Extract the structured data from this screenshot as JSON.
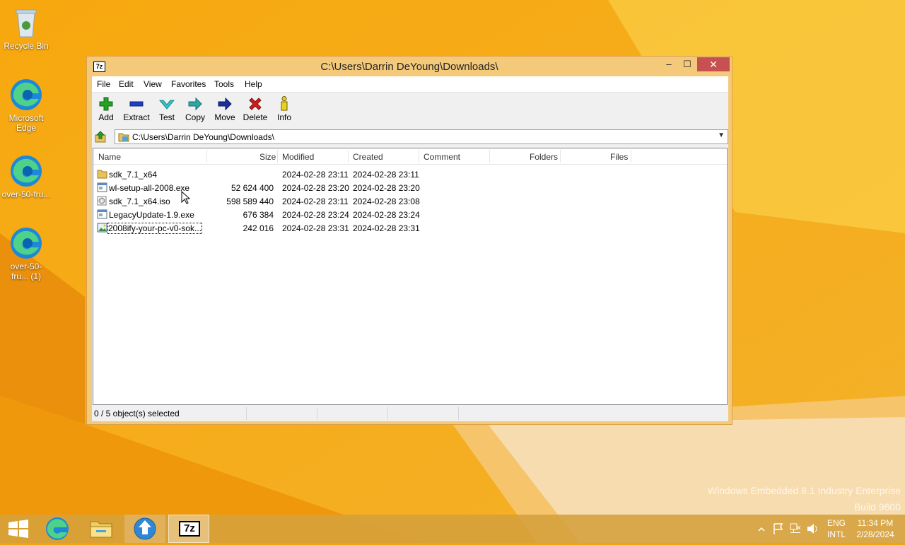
{
  "desktop": {
    "icons": [
      {
        "label": "Recycle Bin"
      },
      {
        "label": "Microsoft Edge"
      },
      {
        "label": "over-50-fru..."
      },
      {
        "label": "over-50-fru... (1)"
      }
    ],
    "watermark": {
      "line1": "Windows Embedded 8.1 Industry Enterprise",
      "line2": "Build 9600"
    }
  },
  "window": {
    "app_icon": "7z",
    "title": "C:\\Users\\Darrin DeYoung\\Downloads\\",
    "controls": {
      "minimize": "–",
      "maximize": "☐",
      "close": "✕"
    },
    "menu": [
      "File",
      "Edit",
      "View",
      "Favorites",
      "Tools",
      "Help"
    ],
    "toolbar": [
      {
        "label": "Add",
        "icon": "plus-icon"
      },
      {
        "label": "Extract",
        "icon": "minus-icon"
      },
      {
        "label": "Test",
        "icon": "check-icon"
      },
      {
        "label": "Copy",
        "icon": "copy-arrow-icon"
      },
      {
        "label": "Move",
        "icon": "move-arrow-icon"
      },
      {
        "label": "Delete",
        "icon": "delete-x-icon"
      },
      {
        "label": "Info",
        "icon": "info-icon"
      }
    ],
    "address": "C:\\Users\\Darrin DeYoung\\Downloads\\",
    "columns": [
      "Name",
      "Size",
      "Modified",
      "Created",
      "Comment",
      "Folders",
      "Files"
    ],
    "files": [
      {
        "name": "sdk_7.1_x64",
        "size": "",
        "modified": "2024-02-28 23:11",
        "created": "2024-02-28 23:11",
        "type": "folder"
      },
      {
        "name": "wl-setup-all-2008.exe",
        "size": "52 624 400",
        "modified": "2024-02-28 23:20",
        "created": "2024-02-28 23:20",
        "type": "exe"
      },
      {
        "name": "sdk_7.1_x64.iso",
        "size": "598 589 440",
        "modified": "2024-02-28 23:11",
        "created": "2024-02-28 23:08",
        "type": "iso"
      },
      {
        "name": "LegacyUpdate-1.9.exe",
        "size": "676 384",
        "modified": "2024-02-28 23:24",
        "created": "2024-02-28 23:24",
        "type": "exe"
      },
      {
        "name": "2008ify-your-pc-v0-sok...",
        "size": "242 016",
        "modified": "2024-02-28 23:31",
        "created": "2024-02-28 23:31",
        "type": "image"
      }
    ],
    "status": "0 / 5 object(s) selected"
  },
  "taskbar": {
    "tray": {
      "lang1": "ENG",
      "lang2": "INTL",
      "time": "11:34 PM",
      "date": "2/28/2024"
    },
    "pinned_7z": "7z"
  }
}
